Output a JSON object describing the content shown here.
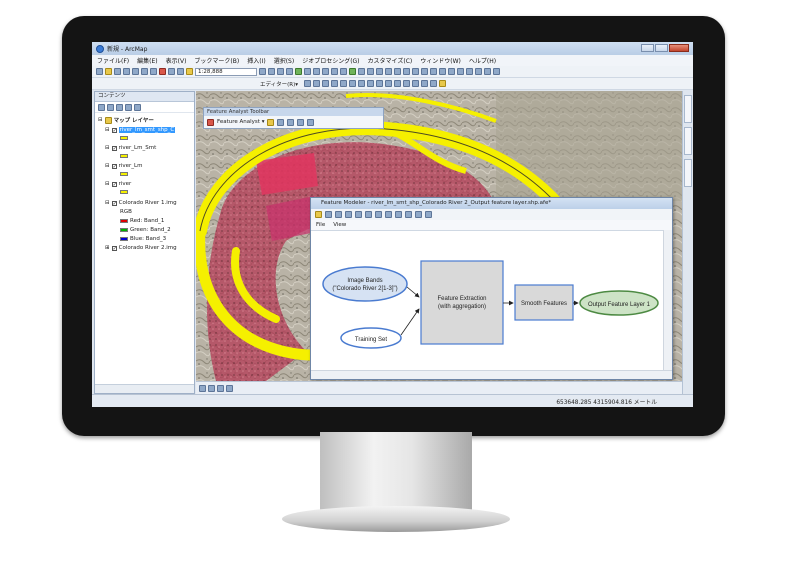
{
  "window": {
    "title": "新規 - ArcMap"
  },
  "menu": [
    "ファイル(F)",
    "編集(E)",
    "表示(V)",
    "ブックマーク(B)",
    "挿入(I)",
    "選択(S)",
    "ジオプロセシング(G)",
    "カスタマイズ(C)",
    "ウィンドウ(W)",
    "ヘルプ(H)"
  ],
  "toolbar": {
    "scale": "1:28,888",
    "editor_label": "エディター(R)▾"
  },
  "toc": {
    "header": "コンテンツ",
    "root": "マップ レイヤー",
    "layers": {
      "l1": "river_lm_smt_shp_C",
      "l2": "river_Lm_Smt",
      "l3": "river_Lm",
      "l4": "river",
      "l5": "Colorado River 1.img",
      "rgb": "RGB",
      "red": "Red:   Band_1",
      "green": "Green: Band_2",
      "blue": "Blue:  Band_3",
      "l6": "Colorado River 2.img"
    }
  },
  "feature_analyst_toolbar": {
    "title": "Feature Analyst Toolbar",
    "button": "Feature Analyst ▾"
  },
  "feature_modeler": {
    "title": "Feature Modeler - river_lm_smt_shp_Colorado River 2_Output feature layer.shp.afe*",
    "menu_file": "File",
    "menu_view": "View",
    "nodes": {
      "image_bands_1": "Image Bands",
      "image_bands_2": "(\"Colorado River 2[1-3]\")",
      "training": "Training Set",
      "extraction_1": "Feature Extraction",
      "extraction_2": "(with aggregation)",
      "smooth": "Smooth Features",
      "output": "Output Feature Layer 1"
    }
  },
  "status": {
    "coords": "653648.285  4315904.816 メートル"
  },
  "colors": {
    "river_yellow": "#f5f000",
    "vegetation_red": "#c8264a",
    "node_gray": "#d9d9d9",
    "node_blue": "#4a7bd0"
  }
}
